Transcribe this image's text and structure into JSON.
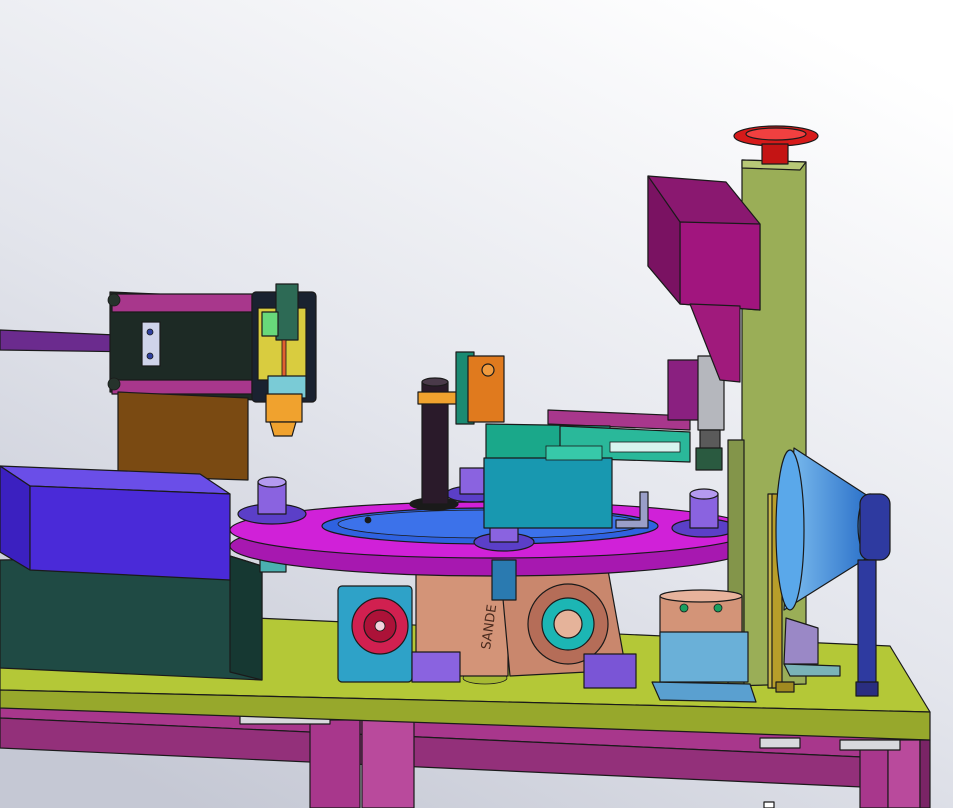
{
  "scene": {
    "motor_housing_label": "SANDE"
  },
  "colors": {
    "background_top": "#ffffff",
    "background_bottom": "#c9ccd8",
    "frame": "#a8378c",
    "base_plate": "#b4c837",
    "column": "#9aae57",
    "turntable": "#d021d8",
    "turntable_disc": "#2f62e0",
    "bin": "#4a2ad8",
    "green_block": "#1d4a45",
    "copper": "#d39478",
    "teal_bracket": "#13a7a8",
    "purple_motor": "#a1157e",
    "orange_part": "#e07a1e",
    "handwheel": "#d61a1a",
    "cone": "#3f8fe0",
    "slate_arm": "#2e3aa0",
    "brown_post": "#7a4a12",
    "dark_tower": "#18362c",
    "fixture_violet": "#8a63e0"
  }
}
